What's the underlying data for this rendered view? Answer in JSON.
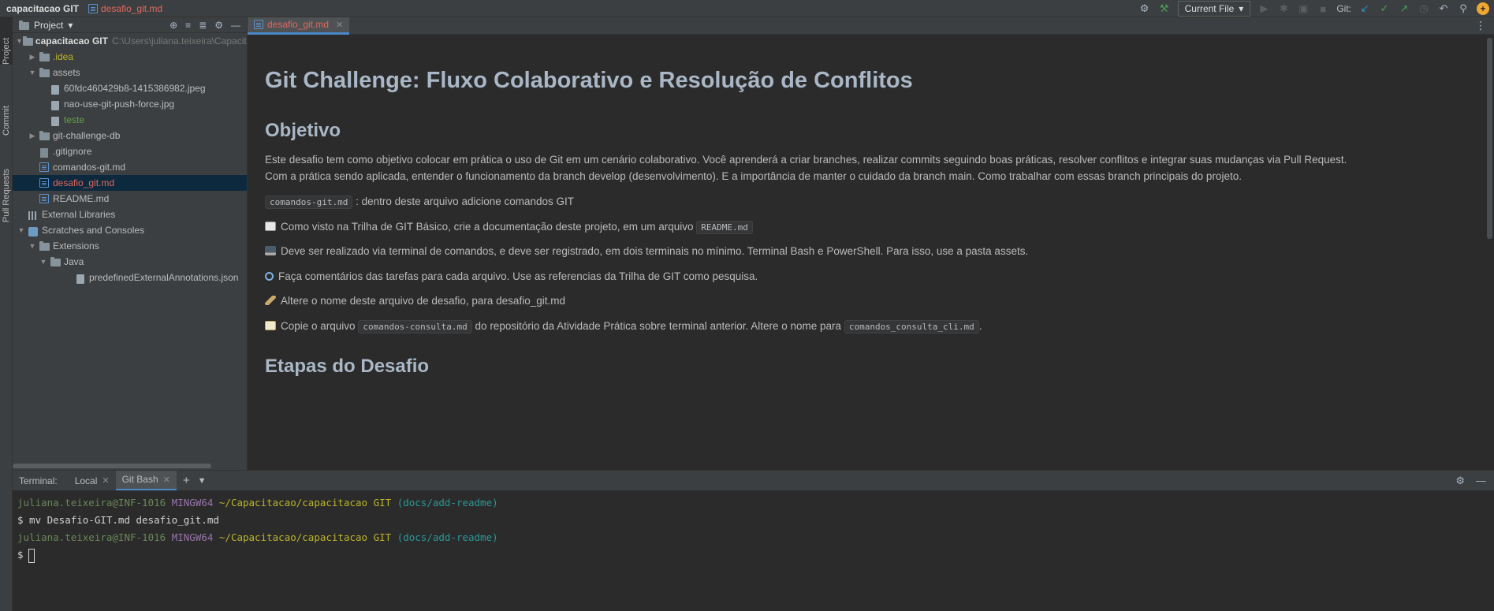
{
  "titlebar": {
    "project": "capacitacao GIT",
    "file": "desafio_git.md",
    "run_config": "Current File",
    "git_label": "Git:"
  },
  "leftstrip": {
    "tabs": [
      "Project",
      "Commit",
      "Pull Requests"
    ]
  },
  "project_panel": {
    "title": "Project",
    "tree": [
      {
        "name": "capacitacao GIT",
        "path": "C:\\Users\\juliana.teixeira\\Capacitacao\\capa",
        "icon": "folder-icon",
        "expanded": true
      },
      {
        "name": ".idea",
        "icon": "folder-icon",
        "expanded": false
      },
      {
        "name": "assets",
        "icon": "folder-icon",
        "expanded": true
      },
      {
        "name": "60fdc460429b8-1415386982.jpeg",
        "icon": "image-file-icon"
      },
      {
        "name": "nao-use-git-push-force.jpg",
        "icon": "image-file-icon"
      },
      {
        "name": "teste",
        "icon": "text-file-icon"
      },
      {
        "name": "git-challenge-db",
        "icon": "folder-icon",
        "expanded": false
      },
      {
        "name": ".gitignore",
        "icon": "gitignore-file-icon"
      },
      {
        "name": "comandos-git.md",
        "icon": "markdown-file-icon"
      },
      {
        "name": "desafio_git.md",
        "icon": "markdown-file-icon",
        "selected": true
      },
      {
        "name": "README.md",
        "icon": "markdown-file-icon"
      },
      {
        "name": "External Libraries",
        "icon": "libraries-icon"
      },
      {
        "name": "Scratches and Consoles",
        "icon": "scratches-icon",
        "expanded": true
      },
      {
        "name": "Extensions",
        "icon": "folder-icon",
        "expanded": true
      },
      {
        "name": "Java",
        "icon": "folder-icon",
        "expanded": true
      },
      {
        "name": "predefinedExternalAnnotations.json",
        "icon": "json-file-icon"
      }
    ]
  },
  "editor": {
    "tab_label": "desafio_git.md",
    "h1": "Git Challenge: Fluxo Colaborativo e Resolução de Conflitos",
    "h2_objetivo": "Objetivo",
    "p1_line1": "Este desafio tem como objetivo colocar em prática o uso de Git em um cenário colaborativo. Você aprenderá a criar branches, realizar commits seguindo boas práticas, resolver conflitos e integrar suas mudanças via Pull Request.",
    "p1_line2": "Com a prática sendo aplicada, entender o funcionamento da branch develop (desenvolvimento). E a importância de manter o cuidado da branch main. Como trabalhar com essas branch principais do projeto.",
    "p2_code": "comandos-git.md",
    "p2_text": ": dentro deste arquivo adicione comandos GIT",
    "p3_text": "Como visto na Trilha de GIT Básico, crie a documentação deste projeto, em um arquivo",
    "p3_code": "README.md",
    "p4_text": "Deve ser realizado via terminal de comandos, e deve ser registrado, em dois terminais no mínimo. Terminal Bash e PowerShell. Para isso, use a pasta assets.",
    "p5_text": "Faça comentários das tarefas para cada arquivo. Use as referencias da Trilha de GIT como pesquisa.",
    "p6_text": "Altere o nome deste arquivo de desafio, para desafio_git.md",
    "p7_text_a": "Copie o arquivo",
    "p7_code_a": "comandos-consulta.md",
    "p7_text_b": "do repositório da Atividade Prática sobre terminal anterior. Altere o nome para",
    "p7_code_b": "comandos_consulta_cli.md",
    "p7_text_c": ".",
    "h2_etapas": "Etapas do Desafio"
  },
  "terminal": {
    "label": "Terminal:",
    "tabs": [
      "Local",
      "Git Bash"
    ],
    "active_tab": "Git Bash",
    "lines": [
      {
        "user": "juliana.teixeira@INF-1016",
        "sys": "MINGW64",
        "path": "~/Capacitacao/capacitacao GIT",
        "branch": "(docs/add-readme)"
      },
      {
        "cmd": "$ mv Desafio-GIT.md desafio_git.md"
      },
      {
        "user": "juliana.teixeira@INF-1016",
        "sys": "MINGW64",
        "path": "~/Capacitacao/capacitacao GIT",
        "branch": "(docs/add-readme)"
      },
      {
        "cmd": "$"
      }
    ]
  },
  "colors": {
    "accent": "#4a88c7",
    "modified_file": "#e0685e",
    "untracked_file": "#62a048",
    "ignored_file": "#bbb529"
  }
}
